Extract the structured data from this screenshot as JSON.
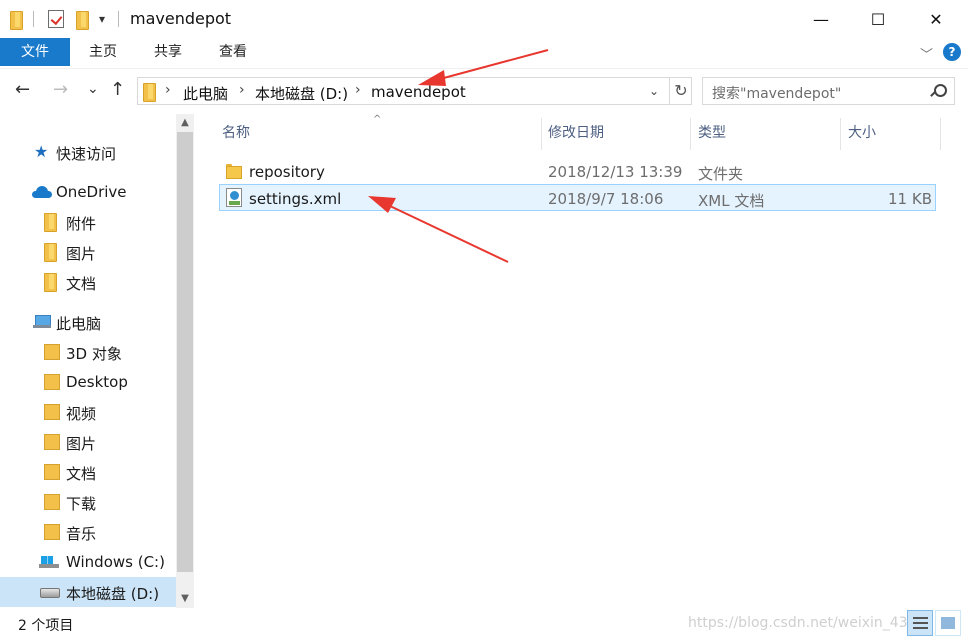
{
  "window": {
    "title": "mavendepot",
    "quick_access_dropdown": "▾",
    "minimize": "—",
    "maximize": "☐",
    "close": "✕"
  },
  "ribbon": {
    "tabs": [
      "文件",
      "主页",
      "共享",
      "查看"
    ],
    "collapse_chevron": "﹀",
    "help": "?"
  },
  "nav": {
    "back": "←",
    "forward": "→",
    "recent": "⌄",
    "up": "↑",
    "breadcrumbs": [
      "此电脑",
      "本地磁盘 (D:)",
      "mavendepot"
    ],
    "separator": "›",
    "address_dropdown": "⌄",
    "refresh": "↻",
    "search_placeholder": "搜索\"mavendepot\""
  },
  "sidebar": {
    "items": [
      {
        "label": "快速访问",
        "icon": "star-icon"
      },
      {
        "label": "OneDrive",
        "icon": "cloud-icon"
      },
      {
        "label": "附件",
        "icon": "folder-icon"
      },
      {
        "label": "图片",
        "icon": "folder-icon"
      },
      {
        "label": "文档",
        "icon": "folder-icon"
      },
      {
        "label": "此电脑",
        "icon": "computer-icon"
      },
      {
        "label": "3D 对象",
        "icon": "3d-objects-icon"
      },
      {
        "label": "Desktop",
        "icon": "desktop-folder-icon"
      },
      {
        "label": "视频",
        "icon": "videos-folder-icon"
      },
      {
        "label": "图片",
        "icon": "pictures-folder-icon"
      },
      {
        "label": "文档",
        "icon": "documents-folder-icon"
      },
      {
        "label": "下载",
        "icon": "downloads-folder-icon"
      },
      {
        "label": "音乐",
        "icon": "music-folder-icon"
      },
      {
        "label": "Windows (C:)",
        "icon": "windows-drive-icon"
      },
      {
        "label": "本地磁盘 (D:)",
        "icon": "drive-icon",
        "selected": true
      }
    ],
    "scroll_up": "▲",
    "scroll_down": "▼"
  },
  "filelist": {
    "columns": [
      "名称",
      "修改日期",
      "类型",
      "大小"
    ],
    "sort_indicator": "^",
    "rows": [
      {
        "name": "repository",
        "modified": "2018/12/13 13:39",
        "type": "文件夹",
        "size": "",
        "icon": "folder-icon"
      },
      {
        "name": "settings.xml",
        "modified": "2018/9/7 18:06",
        "type": "XML 文档",
        "size": "11 KB",
        "icon": "xml-file-icon",
        "selected": true
      }
    ]
  },
  "status": {
    "item_count": "2 个项目",
    "watermark": "https://blog.csdn.net/weixin_43"
  },
  "colors": {
    "accent": "#1979ca",
    "selection": "#cce4f7",
    "row_selection": "#e5f3ff",
    "annotation_arrow": "#e8372f"
  }
}
